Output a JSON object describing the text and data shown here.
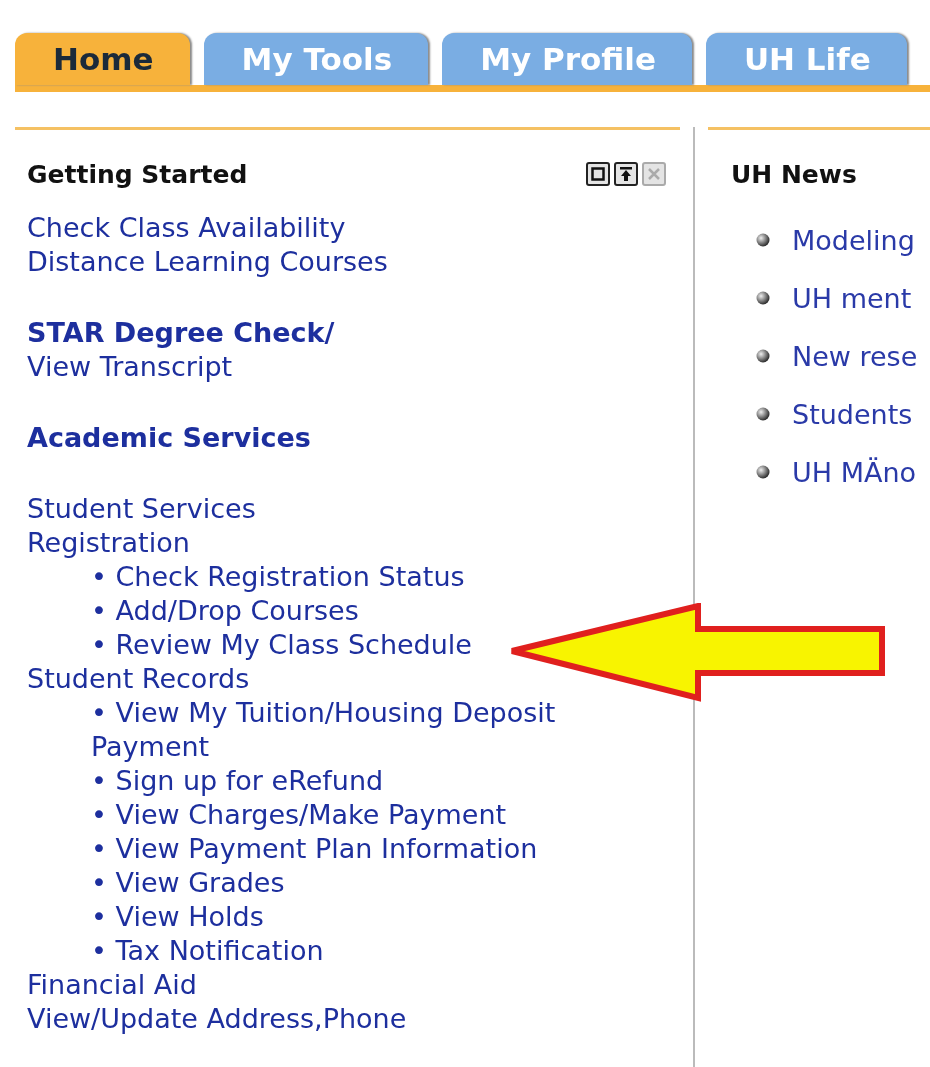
{
  "tabs": [
    {
      "label": "Home",
      "selected": true
    },
    {
      "label": "My Tools",
      "selected": false
    },
    {
      "label": "My Profile",
      "selected": false
    },
    {
      "label": "UH Life",
      "selected": false
    }
  ],
  "getting_started": {
    "title": "Getting Started",
    "controls": [
      {
        "kind": "maximize",
        "disabled": false
      },
      {
        "kind": "move-top",
        "disabled": false
      },
      {
        "kind": "close",
        "disabled": true
      }
    ],
    "groups": [
      {
        "items": [
          {
            "text": "Check Class Availability",
            "bold": false
          },
          {
            "text": "Distance Learning Courses",
            "bold": false
          }
        ]
      },
      {
        "items": [
          {
            "text": "STAR Degree Check/",
            "bold": true
          },
          {
            "text": "View Transcript",
            "bold": false
          }
        ]
      },
      {
        "items": [
          {
            "text": "Academic Services",
            "bold": true
          }
        ]
      },
      {
        "items": [
          {
            "text": "Student Services",
            "bold": false
          },
          {
            "text": "Registration",
            "bold": false,
            "children": [
              {
                "text": "• Check Registration Status"
              },
              {
                "text": "• Add/Drop Courses"
              },
              {
                "text": "• Review My Class Schedule"
              }
            ]
          },
          {
            "text": "Student Records",
            "bold": false,
            "children": [
              {
                "text": "• View My Tuition/Housing Deposit Payment"
              },
              {
                "text": "• Sign up for eRefund"
              },
              {
                "text": "• View Charges/Make Payment"
              },
              {
                "text": "• View Payment Plan Information"
              },
              {
                "text": "• View Grades"
              },
              {
                "text": "• View Holds"
              },
              {
                "text": "• Tax Notification"
              }
            ]
          },
          {
            "text": "Financial Aid",
            "bold": false
          },
          {
            "text": "View/Update Address,Phone",
            "bold": false
          }
        ]
      }
    ]
  },
  "uh_news": {
    "title": "UH News",
    "items": [
      "Modeling",
      "UH ment",
      "New rese",
      "Students",
      "UH MÄno"
    ]
  }
}
